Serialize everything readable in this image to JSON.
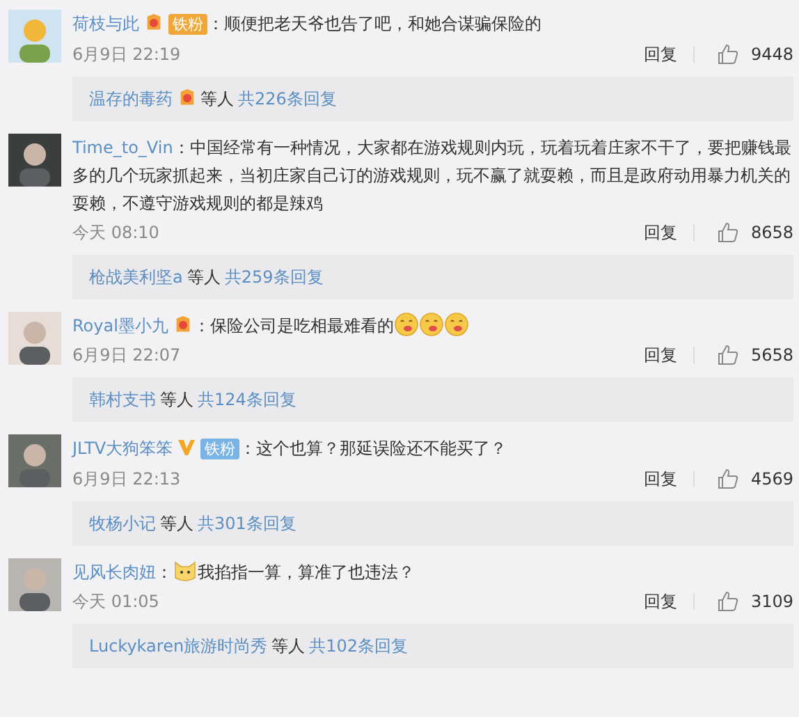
{
  "comments": [
    {
      "user": "荷枝与此",
      "badges": [
        {
          "kind": "level"
        },
        {
          "kind": "fan",
          "text": "铁粉",
          "color": "#f0a73a"
        }
      ],
      "separator": "：",
      "content": [
        {
          "kind": "text",
          "text": "顺便把老天爷也告了吧，和她合谋骗保险的"
        }
      ],
      "time": "6月9日 22:19",
      "reply": "回复",
      "likes": "9448",
      "thread": {
        "user": "温存的毒药",
        "badge": true,
        "others": "等人",
        "total": "共226条回复"
      }
    },
    {
      "user": "Time_to_Vin",
      "separator": "：",
      "content": [
        {
          "kind": "text",
          "text": "中国经常有一种情况，大家都在游戏规则内玩，玩着玩着庄家不干了，要把赚钱最多的几个玩家抓起来，当初庄家自己订的游戏规则，玩不赢了就耍赖，而且是政府动用暴力机关的耍赖，不遵守游戏规则的都是辣鸡"
        }
      ],
      "time": "今天 08:10",
      "reply": "回复",
      "likes": "8658",
      "thread": {
        "user": "枪战美利坚a",
        "badge": false,
        "others": "等人",
        "total": "共259条回复"
      }
    },
    {
      "user": "Royal墨小九",
      "badges": [
        {
          "kind": "level"
        }
      ],
      "separator": "：",
      "content": [
        {
          "kind": "text",
          "text": "保险公司是吃相最难看的"
        },
        {
          "kind": "emoji"
        },
        {
          "kind": "emoji"
        },
        {
          "kind": "emoji"
        }
      ],
      "time": "6月9日 22:07",
      "reply": "回复",
      "likes": "5658",
      "thread": {
        "user": "韩村支书",
        "badge": false,
        "others": "等人",
        "total": "共124条回复"
      }
    },
    {
      "user": "JLTV大狗笨笨",
      "badges": [
        {
          "kind": "verified"
        },
        {
          "kind": "fan",
          "text": "铁粉",
          "color": "#7ab3e6"
        }
      ],
      "separator": "：",
      "content": [
        {
          "kind": "text",
          "text": "这个也算？那延误险还不能买了？"
        }
      ],
      "time": "6月9日 22:13",
      "reply": "回复",
      "likes": "4569",
      "thread": {
        "user": "牧杨小记",
        "badge": false,
        "others": "等人",
        "total": "共301条回复"
      }
    },
    {
      "user": "见风长肉妞",
      "separator": "：",
      "content": [
        {
          "kind": "cat"
        },
        {
          "kind": "text",
          "text": "我掐指一算，算准了也违法？"
        }
      ],
      "time": "今天 01:05",
      "reply": "回复",
      "likes": "3109",
      "thread": {
        "user": "Luckykaren旅游时尚秀",
        "badge": false,
        "others": "等人",
        "total": "共102条回复"
      }
    }
  ]
}
